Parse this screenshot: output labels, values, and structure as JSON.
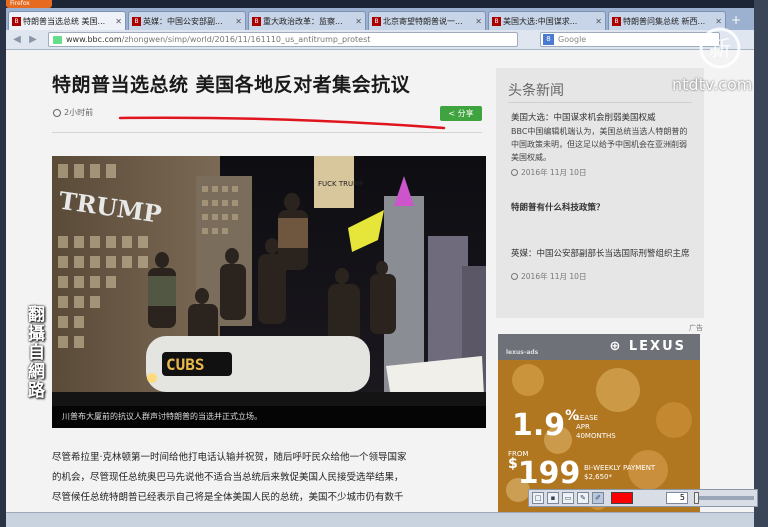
{
  "browser": {
    "menu_button": "Firefox",
    "tabs": [
      {
        "title": "特朗普当选总统 美国...",
        "active": true
      },
      {
        "title": "英媒：中国公安部副...",
        "active": false
      },
      {
        "title": "重大政治改革：监察...",
        "active": false
      },
      {
        "title": "北京寄望特朗普说一...",
        "active": false
      },
      {
        "title": "美国大选:中国谋求...",
        "active": false
      },
      {
        "title": "特朗普问集总统 新西...",
        "active": false
      }
    ],
    "new_tab": "+",
    "url_host": "www.bbc.com",
    "url_path": "/zhongwen/simp/world/2016/11/161110_us_antitrump_protest",
    "search_placeholder": "Google"
  },
  "article": {
    "headline": "特朗普当选总统 美国各地反对者集会抗议",
    "time": "2小时前",
    "share_label": "分享",
    "caption": "川普布大厦前的抗议人群声讨特朗普的当选并正式立场。",
    "body": [
      "尽管希拉里·克林顿第一时间给他打电话认输并祝贺，随后呼吁民众给他一个领导国家",
      "的机会，尽管现任总统奥巴马先说他不适合当总统后来敦促美国人民接受选举结果，",
      "尽管候任总统特朗普已经表示自己将是全体美国人民的总统，美国不少城市仍有数千"
    ],
    "photo_signs": {
      "building_sign": "TRUMP",
      "car_sign": "CUBS",
      "protest_sign": "FUCK TRUMP"
    }
  },
  "overlay": {
    "vertical_text": "翻攝自網路"
  },
  "sidebar": {
    "title": "头条新闻",
    "items": [
      {
        "headline": "美国大选：中国谋求机会削弱美国权威",
        "summary": "BBC中国编辑机端认为，美国总统当选人特朗普的中国政策未明，但这足以给予中国机会在亚洲削弱美国权威。",
        "date": "2016年 11月 10日"
      },
      {
        "headline": "特朗普有什么科技政策？",
        "summary": "",
        "date": ""
      },
      {
        "headline": "英媒：中国公安部副部长当选国际刑警组织主席",
        "summary": "",
        "date": "2016年 11月 10日"
      }
    ]
  },
  "ad": {
    "label": "广告",
    "source": "lexus-ads",
    "brand": "LEXUS",
    "rate": "1.9",
    "rate_unit": "%",
    "lease_text": [
      "LEASE",
      "APR",
      "40MONTHS"
    ],
    "from_text": "FROM",
    "price": "199",
    "price_unit": "$",
    "payment_text": [
      "BI-WEEKLY PAYMENT",
      "$2,650*"
    ]
  },
  "draw_toolbar": {
    "size": "5",
    "color": "#ff0000"
  },
  "watermark": {
    "text": "ntdtv.com",
    "logo_glyph": "新"
  }
}
